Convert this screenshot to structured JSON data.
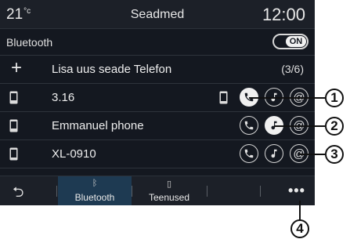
{
  "header": {
    "temperature": "21",
    "temp_unit": "°c",
    "title": "Seadmed",
    "clock": "12:00"
  },
  "bluetooth": {
    "label": "Bluetooth",
    "toggle": "ON"
  },
  "add": {
    "label": "Lisa uus seade Telefon",
    "count": "(3/6)"
  },
  "devices": [
    {
      "name": "3.16",
      "icon": "phone-icon"
    },
    {
      "name": "Emmanuel phone",
      "icon": "phone-icon"
    },
    {
      "name": "XL-0910",
      "icon": "phone-icon"
    }
  ],
  "tabs": [
    {
      "label": "Bluetooth",
      "icon": "bluetooth-icon"
    },
    {
      "label": "Teenused",
      "icon": "phone-icon"
    }
  ],
  "callouts": [
    "1",
    "2",
    "3",
    "4"
  ],
  "colors": {
    "background": "#141820",
    "active_tab": "#1e3a52",
    "text": "#e8e8e8"
  }
}
